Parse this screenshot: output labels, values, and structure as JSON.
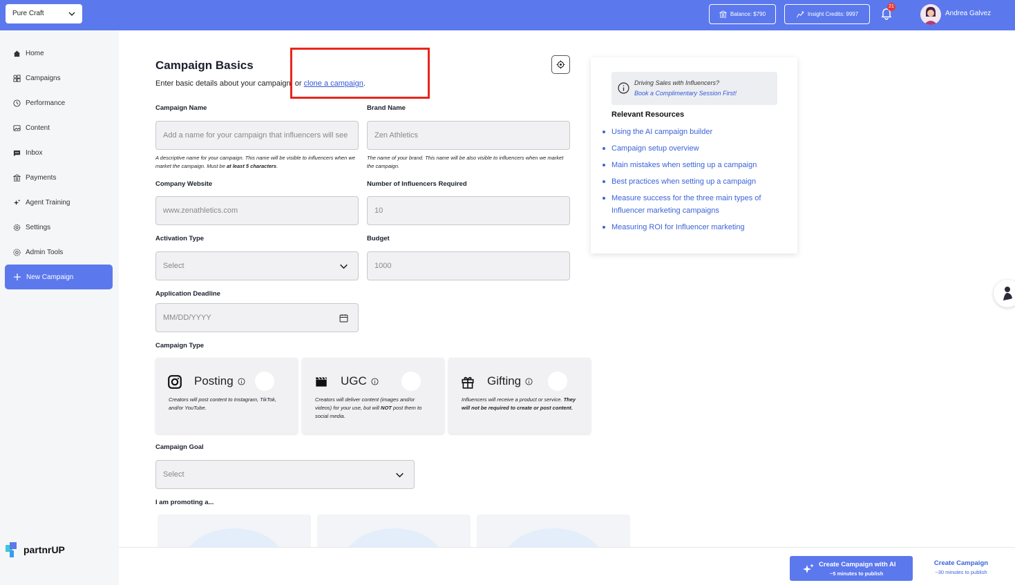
{
  "header": {
    "workspace": "Pure Craft",
    "balance": "Balance: $790",
    "insight_credits": "Insight Credits: 9997",
    "notification_count": "21",
    "user_name": "Andrea Galvez"
  },
  "sidebar": {
    "items": [
      {
        "label": "Home",
        "icon": "home-icon"
      },
      {
        "label": "Campaigns",
        "icon": "grid-icon"
      },
      {
        "label": "Performance",
        "icon": "clock-icon"
      },
      {
        "label": "Content",
        "icon": "image-icon"
      },
      {
        "label": "Inbox",
        "icon": "chat-icon"
      },
      {
        "label": "Payments",
        "icon": "bank-icon"
      },
      {
        "label": "Agent Training",
        "icon": "sparkle-icon"
      },
      {
        "label": "Settings",
        "icon": "gear-icon"
      },
      {
        "label": "Admin Tools",
        "icon": "admin-gear-icon"
      }
    ],
    "new_campaign": "New Campaign",
    "logo": "partnrUP"
  },
  "main": {
    "title": "Campaign Basics",
    "subtitle_prefix": "Enter basic details about your campaign, or ",
    "clone_link": "clone a campaign",
    "subtitle_suffix": ".",
    "fields": {
      "campaign_name": {
        "label": "Campaign Name",
        "placeholder": "Add a name for your campaign that influencers will see",
        "help": "A descriptive name for your campaign. This name will be visible to influencers when we market the campaign. Must be ",
        "help_bold": "at least 5 characters",
        "help_end": "."
      },
      "brand_name": {
        "label": "Brand Name",
        "value": "Zen Athletics",
        "help": "The name of your brand. This name will be also visible to influencers when we market the campaign."
      },
      "company_website": {
        "label": "Company Website",
        "value": "www.zenathletics.com"
      },
      "influencers_required": {
        "label": "Number of Influencers Required",
        "value": "10"
      },
      "activation_type": {
        "label": "Activation Type",
        "value": "Select"
      },
      "budget": {
        "label": "Budget",
        "value": "1000"
      },
      "application_deadline": {
        "label": "Application Deadline",
        "value": "MM/DD/YYYY"
      }
    },
    "campaign_type": {
      "label": "Campaign Type",
      "options": [
        {
          "title": "Posting",
          "icon": "instagram-icon",
          "desc": "Creators will post content to Instagram, TikTok, and/or YouTube.",
          "desc_bold": ""
        },
        {
          "title": "UGC",
          "icon": "clapperboard-icon",
          "desc": "Creators will deliver content (images and/or videos) for your use, but will ",
          "desc_bold": "NOT",
          "desc_end": " post them to social media."
        },
        {
          "title": "Gifting",
          "icon": "gift-icon",
          "desc": "Influencers will receive a product or service. ",
          "desc_bold": "They will not be required to create or post content."
        }
      ]
    },
    "campaign_goal": {
      "label": "Campaign Goal",
      "value": "Select"
    },
    "promoting_label": "I am promoting a..."
  },
  "resources": {
    "promo_line1": "Driving Sales with Influencers?",
    "promo_line2": "Book a Complimentary Session First!",
    "title": "Relevant Resources",
    "links": [
      "Using the AI campaign builder",
      "Campaign setup overview",
      "Main mistakes when setting up a campaign",
      "Best practices when setting up a campaign",
      "Measure success for the three main types of Influencer marketing campaigns",
      "Measuring ROI for Influencer marketing"
    ]
  },
  "footer": {
    "ai_button": "Create Campaign with AI",
    "ai_sub": "~5 minutes to publish",
    "create_button": "Create Campaign",
    "create_sub": "~30 minutes to publish"
  },
  "colors": {
    "primary": "#5b78ed",
    "link": "#3a63d8",
    "highlight": "#e8261c"
  }
}
